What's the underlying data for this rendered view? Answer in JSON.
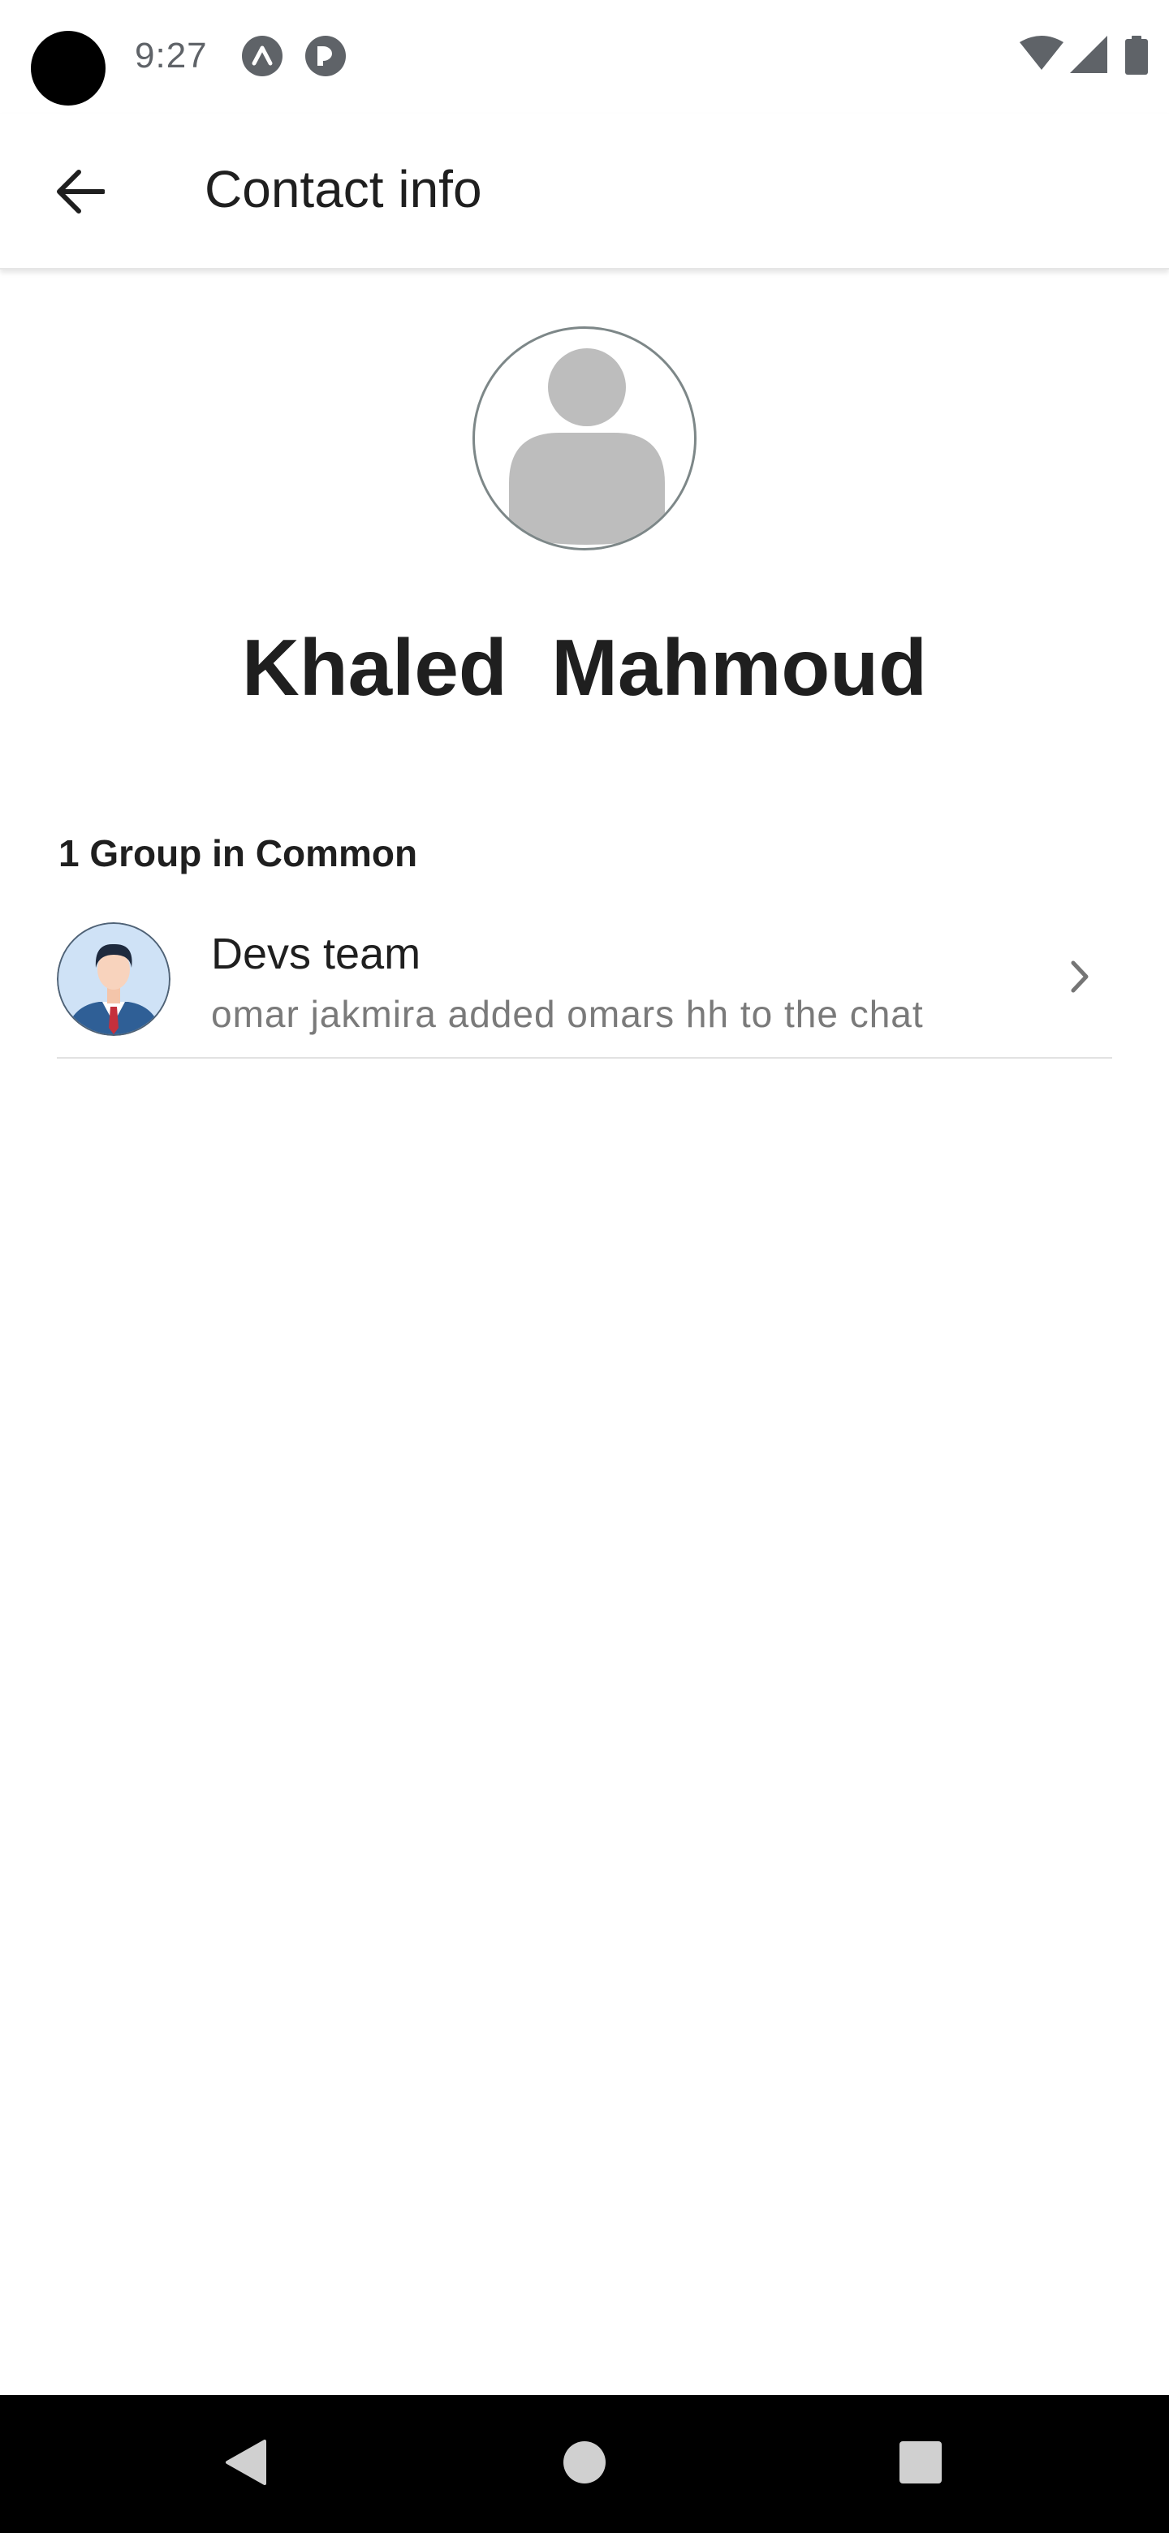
{
  "status_bar": {
    "time": "9:27",
    "icons": [
      "notification-a-icon",
      "notification-p-icon",
      "wifi-icon",
      "cell-signal-icon",
      "battery-icon"
    ]
  },
  "app_bar": {
    "back_icon": "arrow-back-icon",
    "title": "Contact info"
  },
  "profile": {
    "avatar_icon": "default-person-avatar-icon",
    "name": "Khaled  Mahmoud"
  },
  "groups_in_common": {
    "header": "1 Group in Common",
    "items": [
      {
        "name": "Devs team",
        "last_message": "omar jakmira added omars hh to the chat",
        "avatar_icon": "businessman-avatar-icon",
        "chevron_icon": "chevron-right-icon"
      }
    ]
  },
  "nav_bar": {
    "icons": [
      "nav-back-icon",
      "nav-home-icon",
      "nav-recents-icon"
    ]
  },
  "colors": {
    "background": "#ffffff",
    "primary_text": "#1f1f1f",
    "secondary_text": "#7a7a7a",
    "divider": "#e2e2e2",
    "status_icon": "#5f6368",
    "nav_bar": "#000000"
  }
}
